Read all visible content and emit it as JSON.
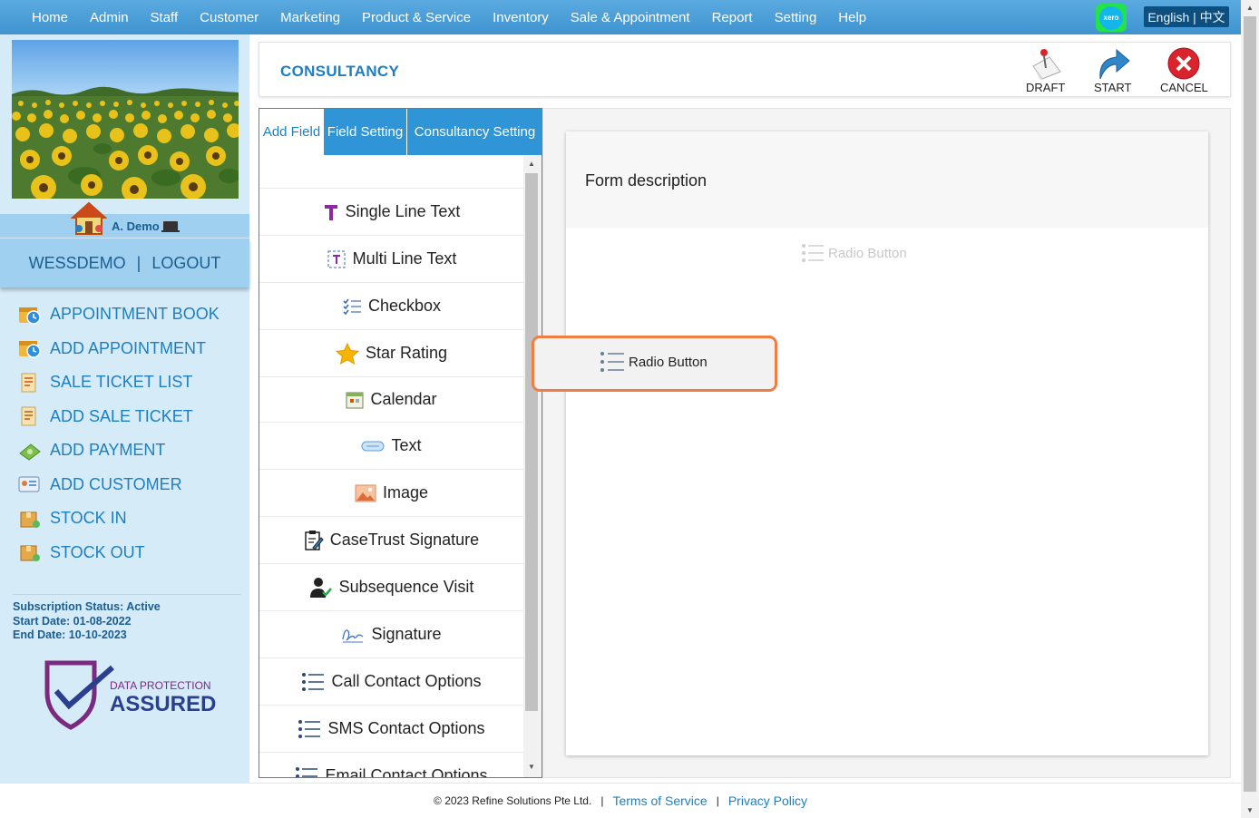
{
  "nav": {
    "items": [
      "Home",
      "Admin",
      "Staff",
      "Customer",
      "Marketing",
      "Product & Service",
      "Inventory",
      "Sale & Appointment",
      "Report",
      "Setting",
      "Help"
    ],
    "xero_label": "xero",
    "language": "English | 中文"
  },
  "sidebar": {
    "user_name": "A. Demo",
    "account": "WESSDEMO",
    "separator": "|",
    "logout": "LOGOUT",
    "menu": [
      {
        "label": "APPOINTMENT BOOK",
        "icon": "calendar-clock-icon"
      },
      {
        "label": "ADD APPOINTMENT",
        "icon": "calendar-clock-icon"
      },
      {
        "label": "SALE TICKET LIST",
        "icon": "receipt-icon"
      },
      {
        "label": "ADD SALE TICKET",
        "icon": "receipt-icon"
      },
      {
        "label": "ADD PAYMENT",
        "icon": "money-icon"
      },
      {
        "label": "ADD CUSTOMER",
        "icon": "customer-card-icon"
      },
      {
        "label": "STOCK IN",
        "icon": "box-in-icon"
      },
      {
        "label": "STOCK OUT",
        "icon": "box-out-icon"
      }
    ],
    "subscription": {
      "status": "Subscription Status: Active",
      "start": "Start Date: 01-08-2022",
      "end": "End Date: 10-10-2023"
    },
    "badge": {
      "line1": "DATA PROTECTION",
      "line2": "ASSURED"
    }
  },
  "header": {
    "title": "CONSULTANCY",
    "draft": "DRAFT",
    "start": "START",
    "cancel": "CANCEL"
  },
  "tabs": {
    "add_field": "Add Field",
    "field_setting": "Field Setting",
    "consultancy_setting": "Consultancy Setting"
  },
  "fields": [
    {
      "label": "Single Line Text",
      "icon": "text-t-icon"
    },
    {
      "label": "Multi Line Text",
      "icon": "text-box-icon"
    },
    {
      "label": "Checkbox",
      "icon": "checklist-icon"
    },
    {
      "label": "Star Rating",
      "icon": "star-icon"
    },
    {
      "label": "Calendar",
      "icon": "calendar-icon"
    },
    {
      "label": "Text",
      "icon": "text-pill-icon"
    },
    {
      "label": "Image",
      "icon": "image-icon"
    },
    {
      "label": "CaseTrust Signature",
      "icon": "document-sign-icon"
    },
    {
      "label": "Subsequence Visit",
      "icon": "user-check-icon"
    },
    {
      "label": "Signature",
      "icon": "signature-icon"
    },
    {
      "label": "Call Contact Options",
      "icon": "list-icon"
    },
    {
      "label": "SMS Contact Options",
      "icon": "list-icon"
    },
    {
      "label": "Email Contact Options",
      "icon": "list-icon"
    }
  ],
  "canvas": {
    "form_description": "Form description",
    "placeholder_field": "Radio Button",
    "dragged_field": "Radio Button"
  },
  "footer": {
    "copyright": "© 2023 Refine Solutions Pte Ltd.",
    "sep": "|",
    "terms": "Terms of Service",
    "privacy": "Privacy Policy"
  },
  "colors": {
    "nav_bg": "#4a9fd8",
    "accent": "#1d7fc2",
    "tab_active": "#2f95d6",
    "drag_border": "#f07d43",
    "cancel_red": "#d9232d"
  }
}
